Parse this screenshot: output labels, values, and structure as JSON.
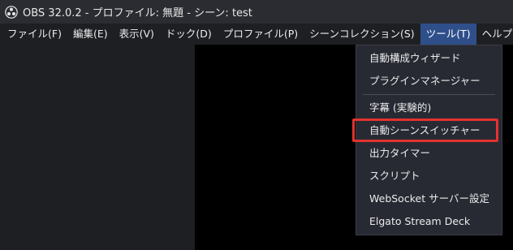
{
  "window": {
    "title": "OBS 32.0.2 - プロファイル: 無題 - シーン: test",
    "icon": "obs-logo-icon"
  },
  "menubar": {
    "items": [
      {
        "label": "ファイル(F)"
      },
      {
        "label": "編集(E)"
      },
      {
        "label": "表示(V)"
      },
      {
        "label": "ドック(D)"
      },
      {
        "label": "プロファイル(P)"
      },
      {
        "label": "シーンコレクション(S)"
      },
      {
        "label": "ツール(T)",
        "active": true
      },
      {
        "label": "ヘルプ(H)"
      }
    ]
  },
  "tools_menu": {
    "items": [
      {
        "label": "自動構成ウィザード"
      },
      {
        "label": "プラグインマネージャー"
      },
      {
        "label": "字幕 (実験的)"
      },
      {
        "label": "自動シーンスイッチャー",
        "highlighted": true
      },
      {
        "label": "出力タイマー"
      },
      {
        "label": "スクリプト"
      },
      {
        "label": "WebSocket サーバー設定"
      },
      {
        "label": "Elgato Stream Deck"
      }
    ]
  },
  "colors": {
    "titlebar_bg": "#2a2c31",
    "menubar_bg": "#1e1f23",
    "active_menu_bg": "#2f4f8a",
    "dropdown_bg": "#272a33",
    "highlight_border": "#e3322f",
    "preview_bg": "#000000"
  }
}
